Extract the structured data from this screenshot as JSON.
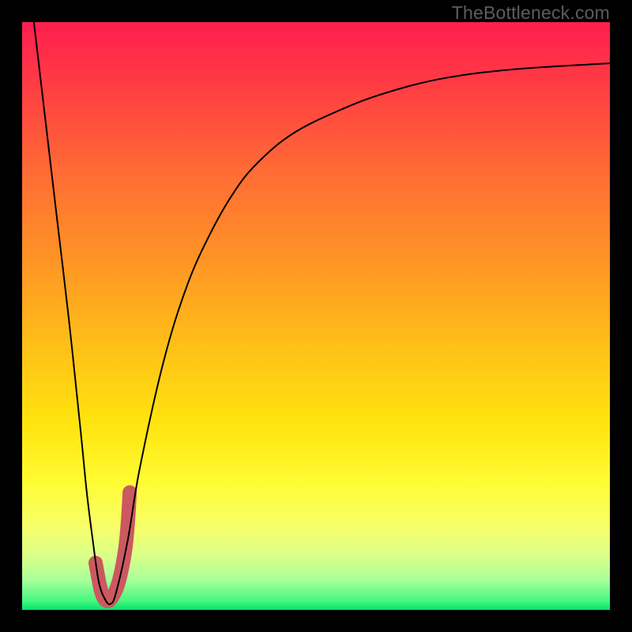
{
  "watermark": "TheBottleneck.com",
  "colors": {
    "highlight": "#cb5960",
    "curve": "#000000",
    "frame_bg": "#000000",
    "gradient_stops": [
      {
        "offset": 0.0,
        "color": "#ff1f4e"
      },
      {
        "offset": 0.1,
        "color": "#ff3a44"
      },
      {
        "offset": 0.25,
        "color": "#ff6a35"
      },
      {
        "offset": 0.4,
        "color": "#ff9326"
      },
      {
        "offset": 0.55,
        "color": "#ffbf18"
      },
      {
        "offset": 0.68,
        "color": "#ffe30e"
      },
      {
        "offset": 0.78,
        "color": "#fffb32"
      },
      {
        "offset": 0.86,
        "color": "#f7ff6a"
      },
      {
        "offset": 0.91,
        "color": "#d9ff8a"
      },
      {
        "offset": 0.95,
        "color": "#a6ff9a"
      },
      {
        "offset": 0.985,
        "color": "#45f77e"
      },
      {
        "offset": 1.0,
        "color": "#00e56b"
      }
    ]
  },
  "chart_data": {
    "type": "line",
    "title": "",
    "xlabel": "",
    "ylabel": "",
    "xlim": [
      0,
      100
    ],
    "ylim": [
      0,
      100
    ],
    "series": [
      {
        "name": "bottleneck-curve",
        "x": [
          2,
          4,
          6,
          8,
          10,
          11,
          12,
          13,
          14,
          15,
          16,
          18,
          20,
          24,
          28,
          32,
          36,
          40,
          46,
          54,
          62,
          72,
          84,
          100
        ],
        "y": [
          100,
          83,
          66,
          49,
          30,
          20,
          12,
          5,
          2,
          1,
          3,
          12,
          24,
          42,
          55,
          64,
          71,
          76,
          81,
          85,
          88,
          90.5,
          92,
          93
        ]
      },
      {
        "name": "optimal-highlight",
        "x": [
          12.5,
          13.5,
          14.5,
          15.5,
          16.5,
          17.5,
          18.0,
          18.3
        ],
        "y": [
          8,
          3,
          1.5,
          2.5,
          5,
          10,
          15,
          20
        ]
      }
    ]
  }
}
